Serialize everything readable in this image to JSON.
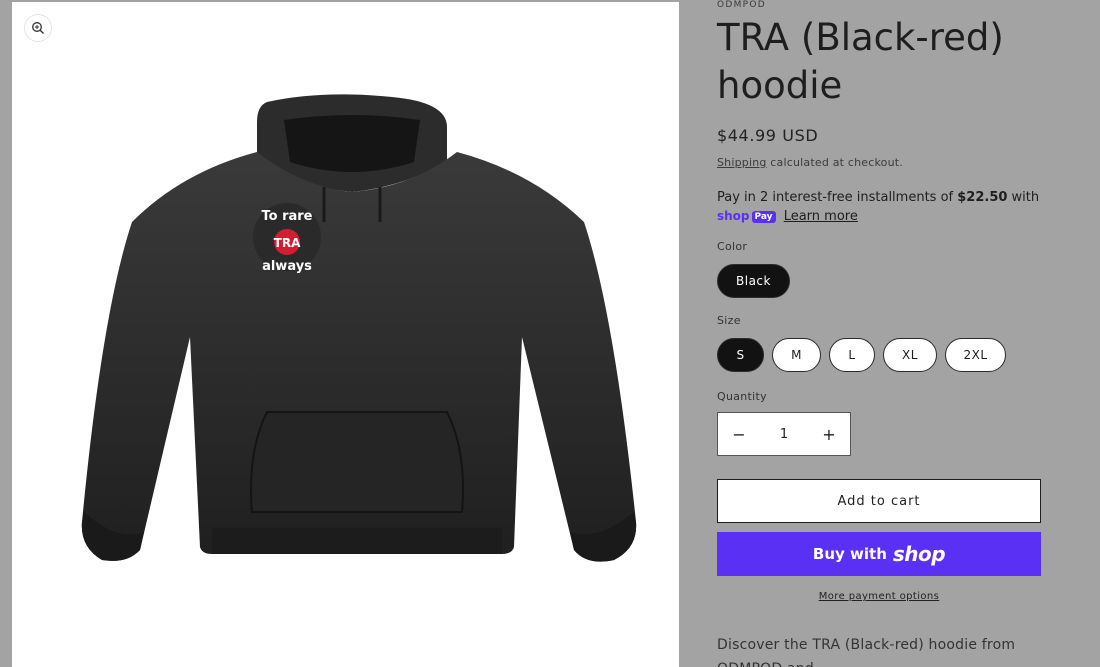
{
  "product": {
    "vendor": "ODMPOD",
    "title": "TRA (Black-red) hoodie",
    "price": "$44.99 USD",
    "shipping_link": "Shipping",
    "shipping_text": " calculated at checkout.",
    "installments_prefix": "Pay in 2 interest-free installments of ",
    "installments_amount": "$22.50",
    "installments_suffix": " with",
    "shoppay_shop": "shop",
    "shoppay_pay": "Pay",
    "learn_more": "Learn more",
    "image_print_text": [
      "To rare",
      "TRA",
      "always"
    ]
  },
  "options": {
    "color_label": "Color",
    "colors": [
      {
        "label": "Black",
        "selected": true
      }
    ],
    "size_label": "Size",
    "sizes": [
      {
        "label": "S",
        "selected": true
      },
      {
        "label": "M",
        "selected": false
      },
      {
        "label": "L",
        "selected": false
      },
      {
        "label": "XL",
        "selected": false
      },
      {
        "label": "2XL",
        "selected": false
      }
    ]
  },
  "quantity": {
    "label": "Quantity",
    "value": "1",
    "minus": "−",
    "plus": "+"
  },
  "actions": {
    "add_to_cart": "Add to cart",
    "buy_with": "Buy with",
    "buy_shop": "shop",
    "more_payment": "More payment options"
  },
  "description": {
    "line1": "Discover the TRA (Black-red) hoodie from",
    "line2": "ODMPOD and ..."
  },
  "colors": {
    "shop_purple": "#5a31f4",
    "page_bg": "#a3a3a3",
    "selected_pill": "#121212"
  },
  "icons": {
    "zoom": "zoom-in-icon"
  }
}
